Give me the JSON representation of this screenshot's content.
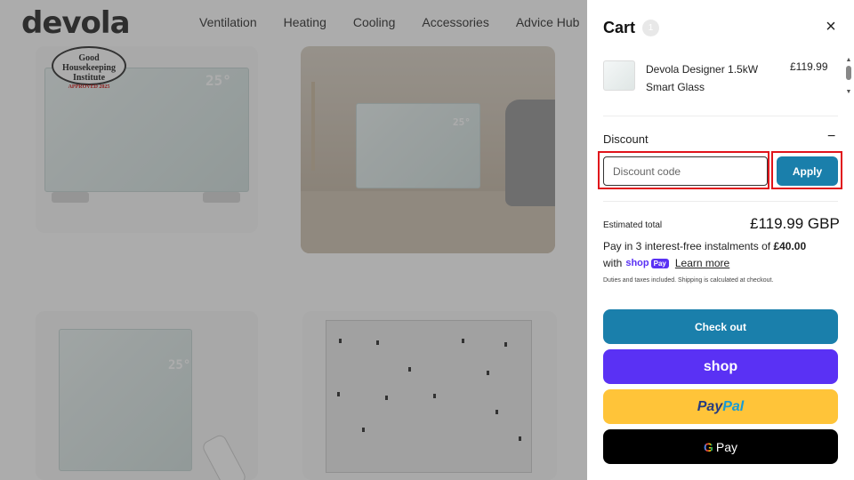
{
  "site": {
    "logo": "devola",
    "nav": [
      "Ventilation",
      "Heating",
      "Cooling",
      "Accessories",
      "Advice Hub"
    ],
    "badge": {
      "line1": "Good Housekeeping",
      "line2": "Institute",
      "line3": "APPROVED 2025"
    },
    "heater_display": "25°"
  },
  "cart": {
    "title": "Cart",
    "count": "1",
    "items": [
      {
        "name": "Devola Designer 1.5kW Smart Glass",
        "price": "£119.99"
      }
    ],
    "discount": {
      "title": "Discount",
      "collapse_symbol": "−",
      "placeholder": "Discount code",
      "apply_label": "Apply"
    },
    "estimated_total_label": "Estimated total",
    "estimated_total": "£119.99 GBP",
    "installments_prefix": "Pay in 3 interest-free instalments of",
    "installments_amount": "£40.00",
    "with_label": "with",
    "shoppay_text": "shop",
    "shoppay_pill": "Pay",
    "learn_more": "Learn more",
    "duties_note": "Duties and taxes included. Shipping is calculated at checkout.",
    "buttons": {
      "checkout": "Check out",
      "shop": "shop",
      "paypal_a": "Pay",
      "paypal_b": "Pal",
      "gpay_g": "G",
      "gpay": "Pay"
    }
  }
}
